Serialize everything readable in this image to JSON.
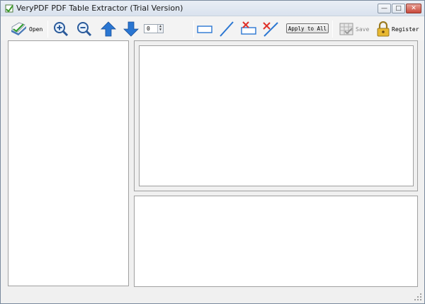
{
  "window": {
    "title": "VeryPDF PDF Table Extractor (Trial Version)",
    "controls": {
      "minimize": "—",
      "maximize": "□",
      "close": "✕"
    }
  },
  "toolbar": {
    "open_label": "Open",
    "page_value": "0",
    "apply_label": "Apply to All",
    "save_label": "Save",
    "register_label": "Register",
    "icons": [
      "open-icon",
      "zoom-in-icon",
      "zoom-out-icon",
      "page-up-icon",
      "page-down-icon",
      "draw-rect-icon",
      "draw-line-icon",
      "delete-rect-icon",
      "delete-line-icon",
      "save-icon",
      "register-lock-icon"
    ]
  },
  "colors": {
    "accent_blue": "#2a76d2",
    "delete_red": "#e0322a",
    "window_bg": "#f0f0f0",
    "pane_border": "#a0a0a0"
  }
}
